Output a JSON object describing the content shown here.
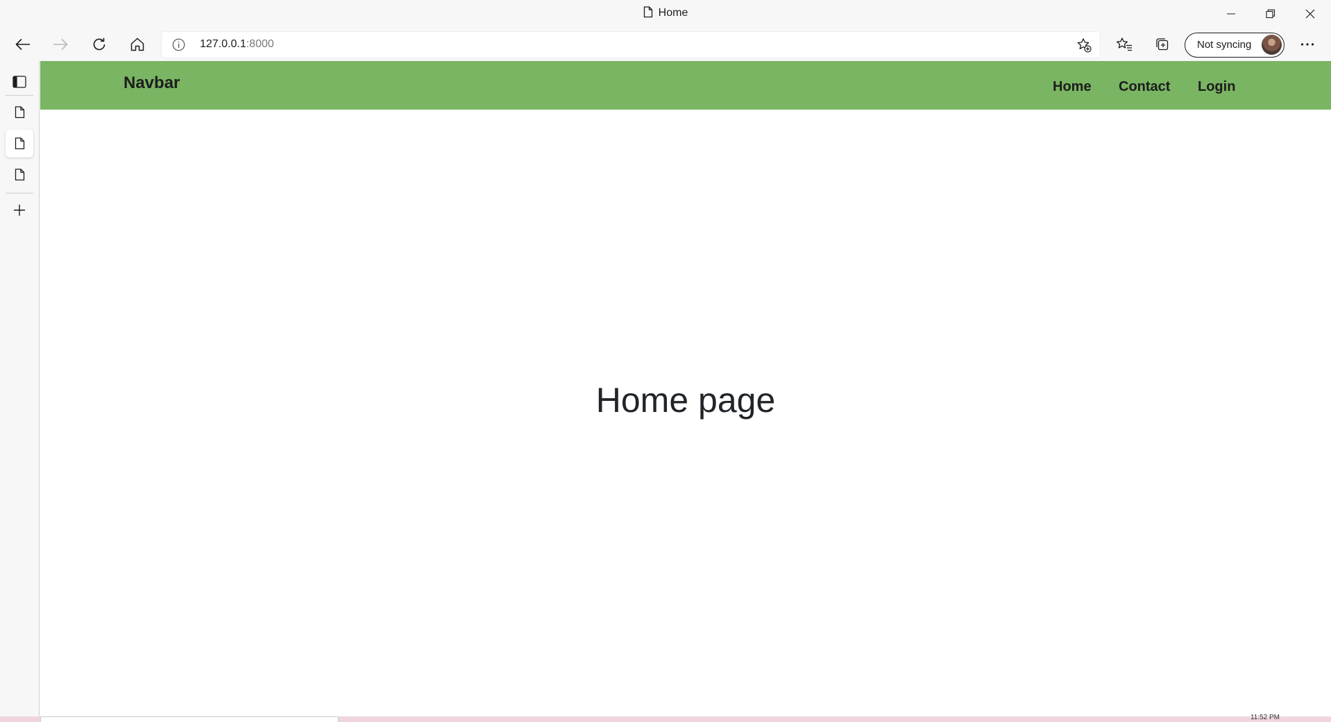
{
  "browser": {
    "tab_title": "Home",
    "url_host": "127.0.0.1",
    "url_port": ":8000",
    "sync_label": "Not syncing"
  },
  "site": {
    "brand": "Navbar",
    "nav_links": [
      "Home",
      "Contact",
      "Login"
    ],
    "navbar_color": "#79b562",
    "heading": "Home page"
  },
  "taskbar": {
    "clock": "11:52 PM"
  }
}
